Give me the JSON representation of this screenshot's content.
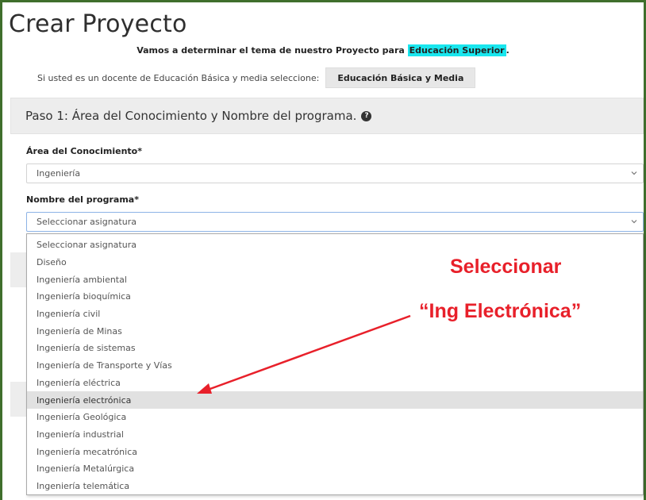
{
  "page": {
    "title": "Crear Proyecto",
    "intro_text": "Vamos a determinar el tema de nuestro Proyecto para ",
    "intro_highlight": "Educación Superior",
    "intro_end": ".",
    "basic_prompt": "Si usted es un docente de Educación Básica y media seleccione:",
    "basic_button": "Educación Básica y Media"
  },
  "step": {
    "title": "Paso 1: Área del Conocimiento y Nombre del programa.",
    "help_icon": "question-circle-icon"
  },
  "area": {
    "label": "Área del Conocimiento*",
    "value": "Ingeniería"
  },
  "program": {
    "label": "Nombre del programa*",
    "value": "Seleccionar asignatura",
    "options": [
      "Seleccionar asignatura",
      "Diseño",
      "Ingeniería ambiental",
      "Ingeniería bioquímica",
      "Ingeniería civil",
      "Ingeniería de Minas",
      "Ingeniería de sistemas",
      "Ingeniería de Transporte y Vías",
      "Ingeniería eléctrica",
      "Ingeniería electrónica",
      "Ingeniería Geológica",
      "Ingeniería industrial",
      "Ingeniería mecatrónica",
      "Ingeniería Metalúrgica",
      "Ingeniería telemática"
    ],
    "highlighted_option": "Ingeniería electrónica"
  },
  "annotation": {
    "line1": "Seleccionar",
    "line2": "“Ing Electrónica”",
    "color": "#e8202a"
  },
  "colors": {
    "frame": "#3f6e2c",
    "highlight": "#19e6ee",
    "panel": "#ededed"
  }
}
